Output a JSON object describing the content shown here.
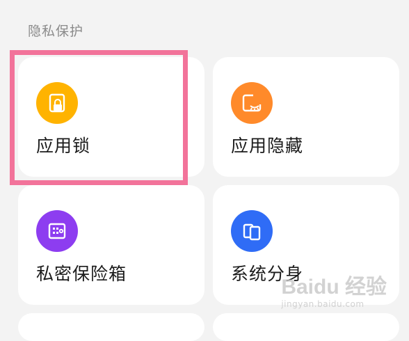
{
  "section": {
    "title": "隐私保护"
  },
  "cards": [
    {
      "label": "应用锁",
      "icon": "app-lock-icon",
      "color": "#FFB300"
    },
    {
      "label": "应用隐藏",
      "icon": "app-hide-icon",
      "color": "#FF8A2A"
    },
    {
      "label": "私密保险箱",
      "icon": "vault-icon",
      "color": "#8D3DF0"
    },
    {
      "label": "系统分身",
      "icon": "dual-system-icon",
      "color": "#2F6CF6"
    }
  ],
  "highlight": {
    "color": "#F2739A"
  },
  "watermark": {
    "brand": "Baidu 经验",
    "url": "jingyan.baidu.com"
  }
}
